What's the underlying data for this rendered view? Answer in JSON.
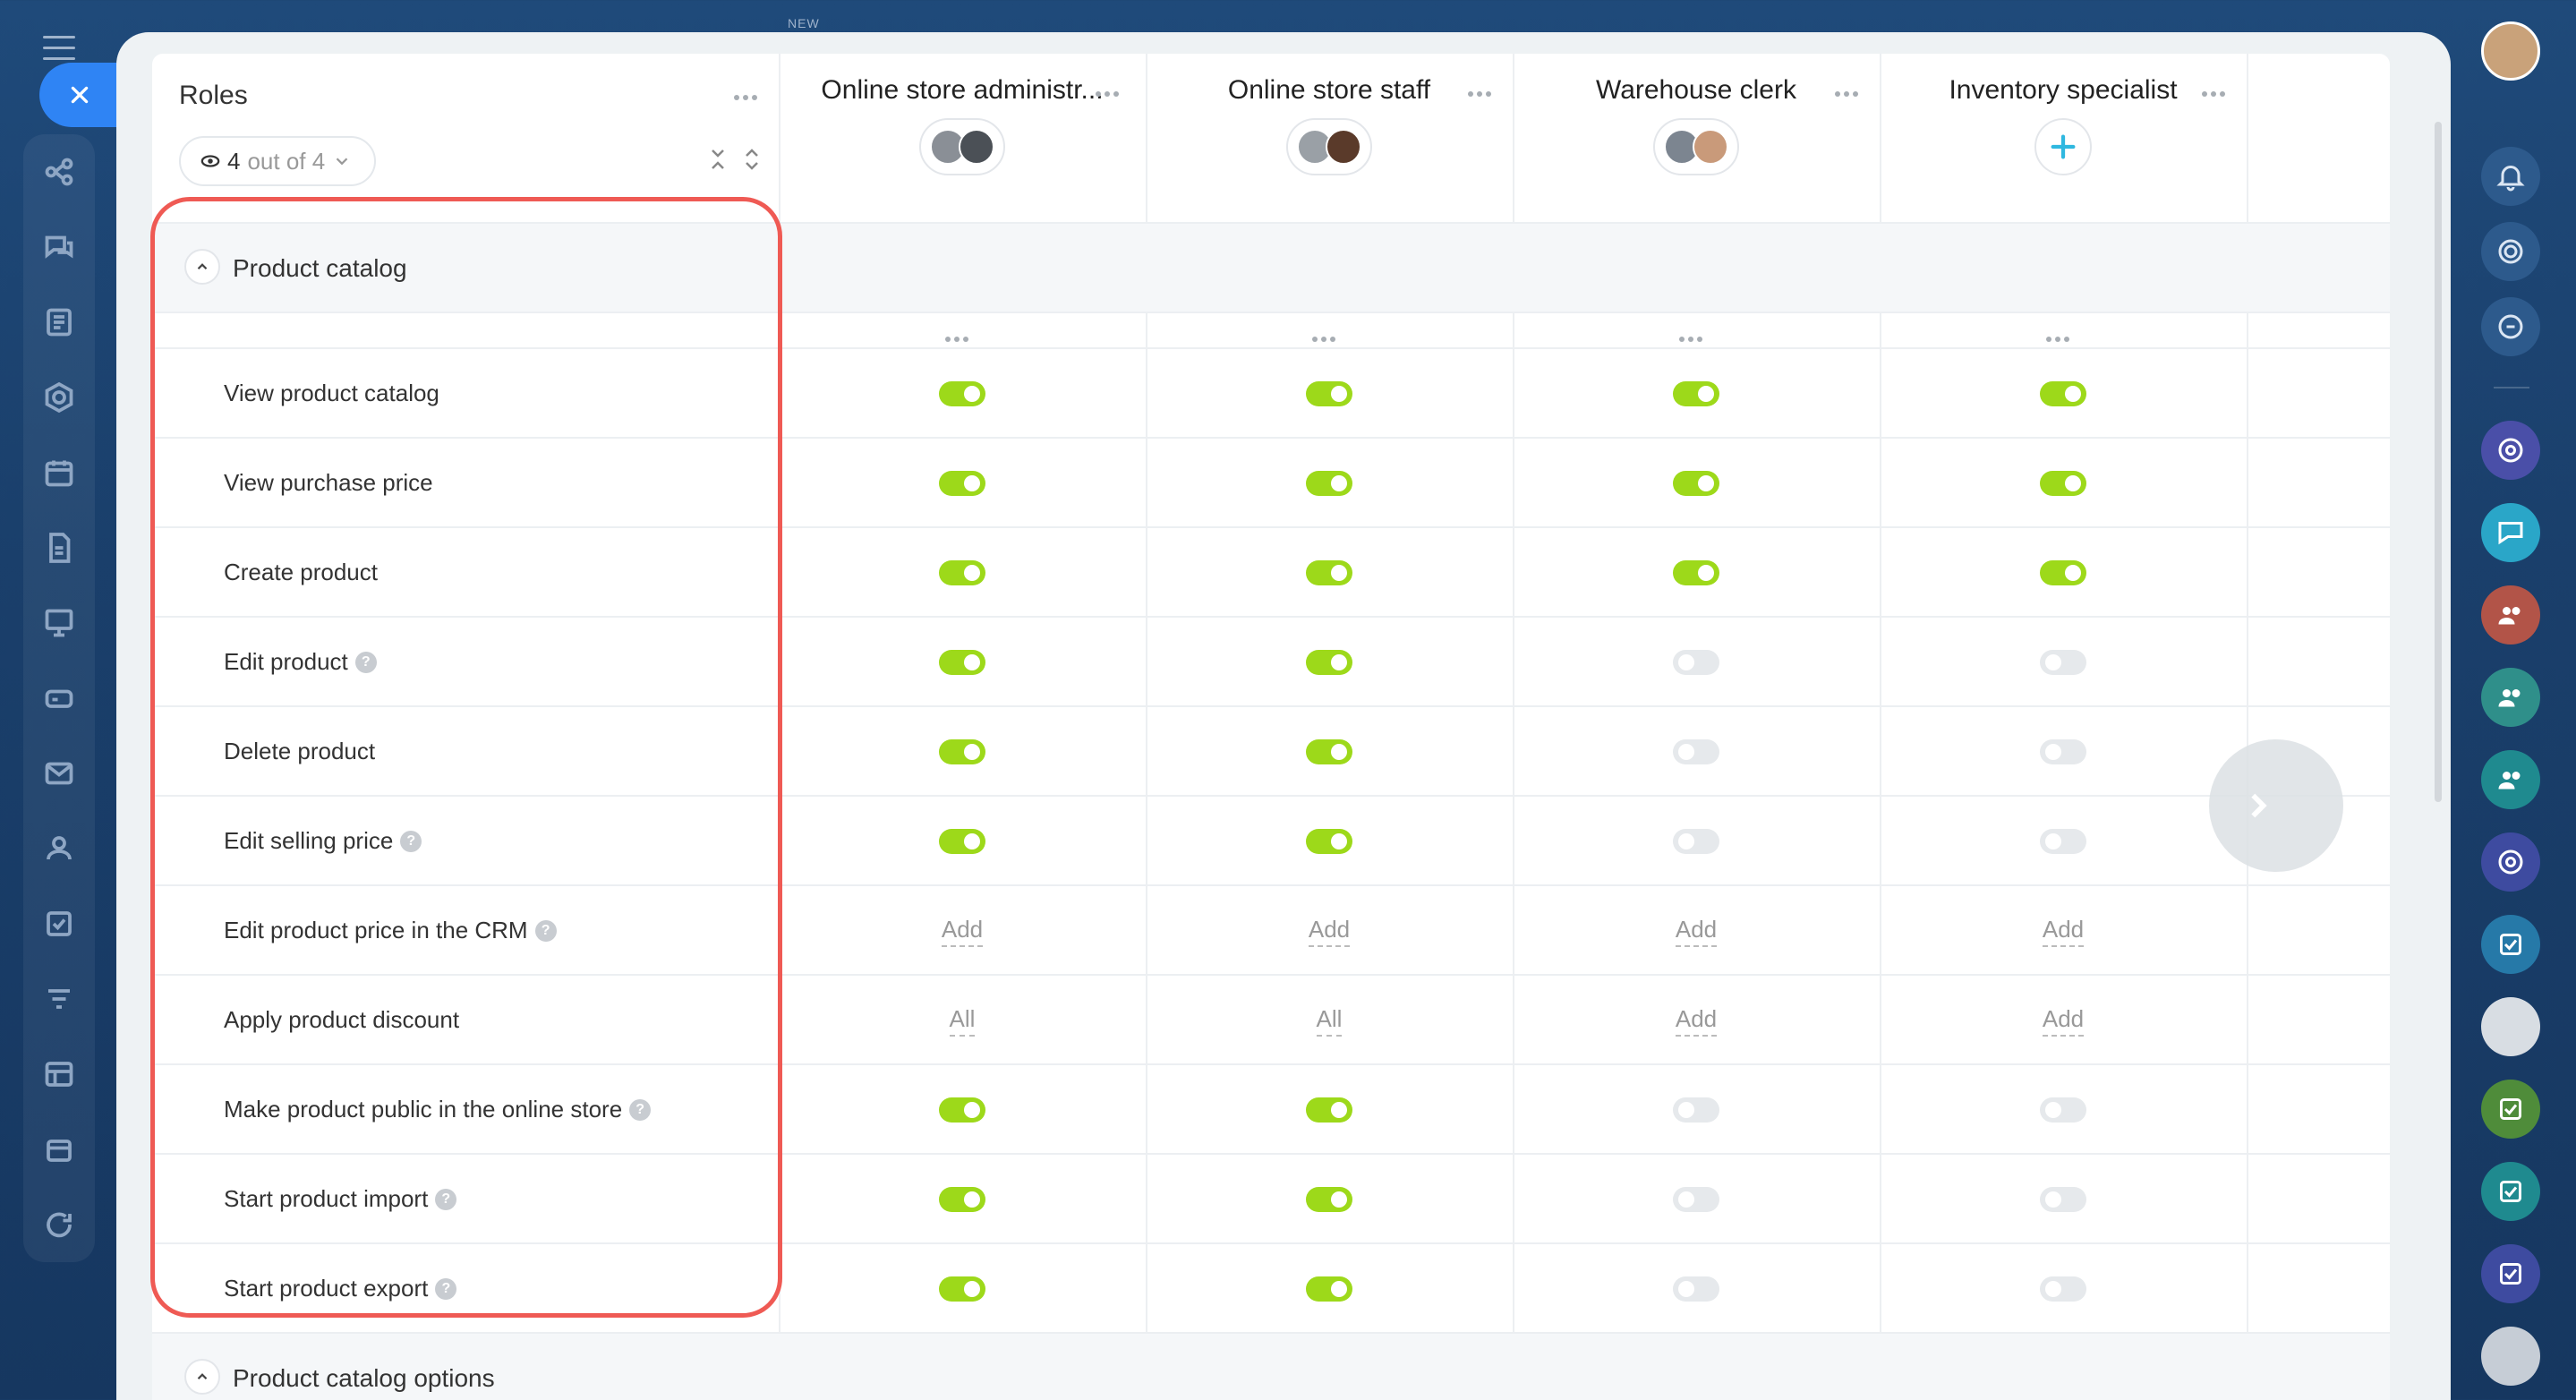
{
  "new_badge": "NEW",
  "roles_header": {
    "title": "Roles",
    "filter_count": "4",
    "filter_of": "out of 4"
  },
  "roles": [
    {
      "name": "Online store administr..."
    },
    {
      "name": "Online store staff"
    },
    {
      "name": "Warehouse clerk"
    },
    {
      "name": "Inventory specialist"
    }
  ],
  "sections": [
    {
      "title": "Product catalog"
    },
    {
      "title": "Product catalog options"
    }
  ],
  "permissions": [
    {
      "label": "View product catalog",
      "help": false,
      "values": [
        "on",
        "on",
        "on",
        "on"
      ]
    },
    {
      "label": "View purchase price",
      "help": false,
      "values": [
        "on",
        "on",
        "on",
        "on"
      ]
    },
    {
      "label": "Create product",
      "help": false,
      "values": [
        "on",
        "on",
        "on",
        "on"
      ]
    },
    {
      "label": "Edit product",
      "help": true,
      "values": [
        "on",
        "on",
        "off",
        "off"
      ]
    },
    {
      "label": "Delete product",
      "help": false,
      "values": [
        "on",
        "on",
        "off",
        "off"
      ]
    },
    {
      "label": "Edit selling price",
      "help": true,
      "values": [
        "on",
        "on",
        "off",
        "off"
      ]
    },
    {
      "label": "Edit product price in the CRM",
      "help": true,
      "values": [
        "Add",
        "Add",
        "Add",
        "Add"
      ]
    },
    {
      "label": "Apply product discount",
      "help": false,
      "values": [
        "All",
        "All",
        "Add",
        "Add"
      ]
    },
    {
      "label": "Make product public in the online store",
      "help": true,
      "values": [
        "on",
        "on",
        "off",
        "off"
      ]
    },
    {
      "label": "Start product import",
      "help": true,
      "values": [
        "on",
        "on",
        "off",
        "off"
      ]
    },
    {
      "label": "Start product export",
      "help": true,
      "values": [
        "on",
        "on",
        "off",
        "off"
      ]
    }
  ],
  "colors": {
    "toggle_on": "#9dd91a",
    "toggle_off": "#e6e9ec",
    "accent": "#2f84f4",
    "highlight": "#ef5a54"
  }
}
